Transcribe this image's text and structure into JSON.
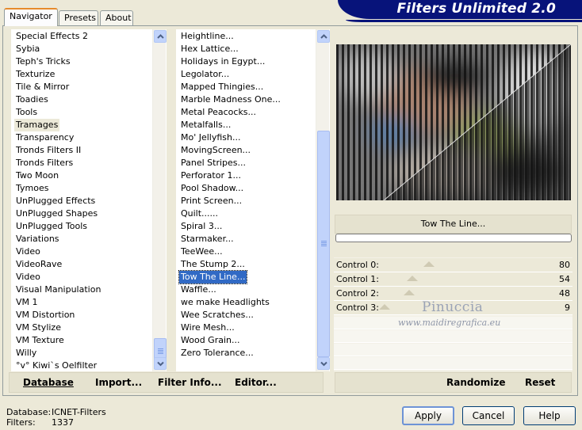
{
  "window": {
    "banner_title": "Filters Unlimited 2.0"
  },
  "tabs": [
    {
      "label": "Navigator",
      "active": true
    },
    {
      "label": "Presets",
      "active": false
    },
    {
      "label": "About",
      "active": false
    }
  ],
  "categories": {
    "items": [
      "Special Effects 2",
      "Sybia",
      "Teph's Tricks",
      "Texturize",
      "Tile & Mirror",
      "Toadies",
      "Tools",
      "Tramages",
      "Transparency",
      "Tronds Filters II",
      "Tronds Filters",
      "Two Moon",
      "Tymoes",
      "UnPlugged Effects",
      "UnPlugged Shapes",
      "UnPlugged Tools",
      "Variations",
      "Video",
      "VideoRave",
      "Video",
      "Visual Manipulation",
      "VM 1",
      "VM Distortion",
      "VM Stylize",
      "VM Texture",
      "Willy",
      "°v° Kiwi`s Oelfilter"
    ],
    "selected": "Tramages"
  },
  "filters": {
    "items": [
      "Heightline...",
      "Hex Lattice...",
      "Holidays in Egypt...",
      "Legolator...",
      "Mapped Thingies...",
      "Marble Madness One...",
      "Metal Peacocks...",
      "Metalfalls...",
      "Mo' Jellyfish...",
      "MovingScreen...",
      "Panel Stripes...",
      "Perforator 1...",
      "Pool Shadow...",
      "Print Screen...",
      "Quilt......",
      "Spiral 3...",
      "Starmaker...",
      "TeeWee...",
      "The Stump 2...",
      "Tow The Line...",
      "Waffle...",
      "we make Headlights",
      "Wee Scratches...",
      "Wire Mesh...",
      "Wood Grain...",
      "Zero Tolerance..."
    ],
    "selected": "Tow The Line..."
  },
  "toolbar_left": {
    "database": "Database",
    "import": "Import...",
    "filter_info": "Filter Info...",
    "editor": "Editor..."
  },
  "toolbar_right": {
    "randomize": "Randomize",
    "reset": "Reset"
  },
  "filter_name": "Tow The Line...",
  "controls": [
    {
      "label": "Control 0:",
      "value": 80
    },
    {
      "label": "Control 1:",
      "value": 54
    },
    {
      "label": "Control 2:",
      "value": 48
    },
    {
      "label": "Control 3:",
      "value": 9
    }
  ],
  "watermark": {
    "line1": "Pinuccia",
    "line2": "www.maidiregrafica.eu"
  },
  "status": {
    "database_label": "Database:",
    "database_value": "ICNET-Filters",
    "filters_label": "Filters:",
    "filters_value": "1337"
  },
  "buttons": {
    "apply": "Apply",
    "cancel": "Cancel",
    "help": "Help"
  },
  "icons": {
    "scroll_up": "chevron-up-icon",
    "scroll_down": "chevron-down-icon"
  },
  "colors": {
    "banner": "#07137a",
    "selection": "#316ac5",
    "tab_accent": "#e68b2c"
  }
}
